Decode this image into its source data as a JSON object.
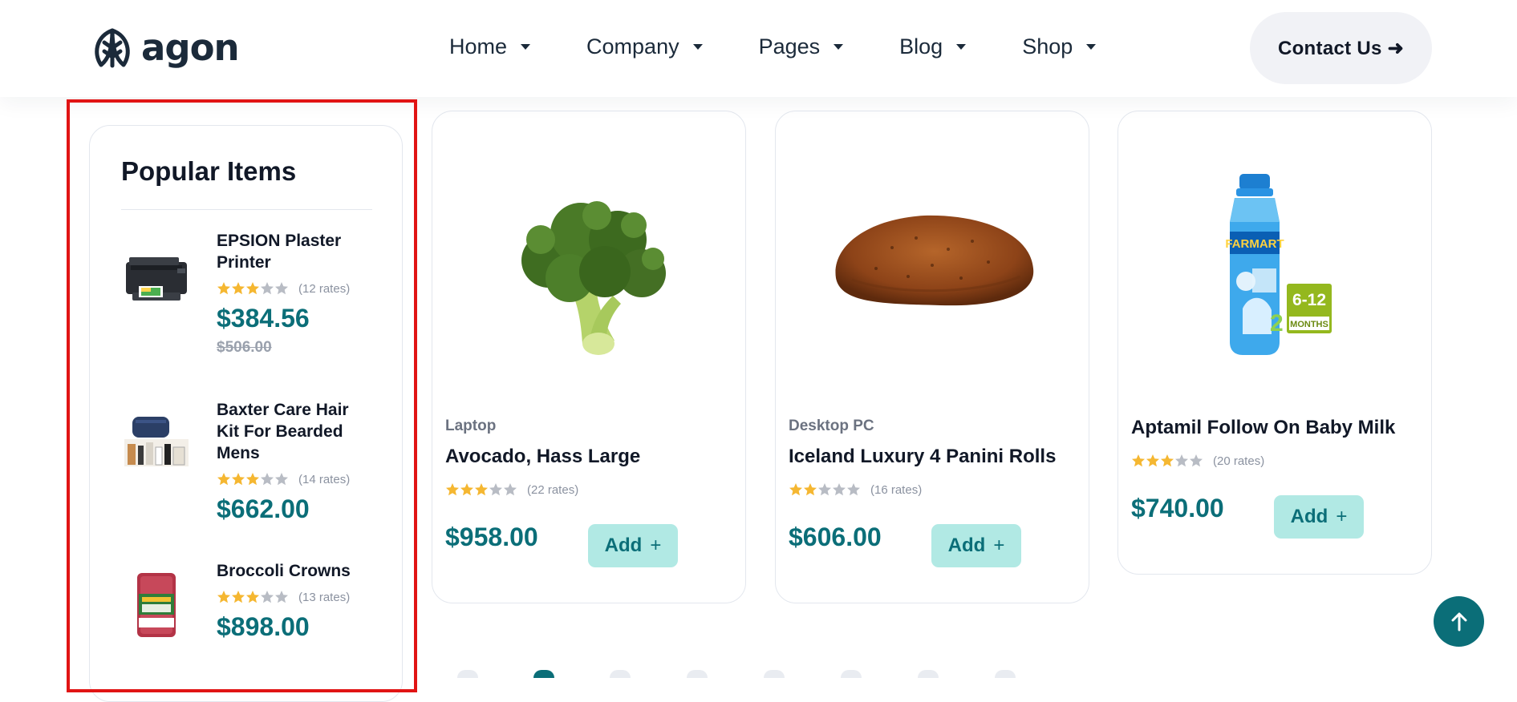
{
  "brand": {
    "name": "agon"
  },
  "nav": {
    "items": [
      {
        "label": "Home"
      },
      {
        "label": "Company"
      },
      {
        "label": "Pages"
      },
      {
        "label": "Blog"
      },
      {
        "label": "Shop"
      }
    ],
    "contact_label": "Contact Us ➜"
  },
  "popular": {
    "title": "Popular Items",
    "items": [
      {
        "name": "EPSION Plaster Printer",
        "rating": 3,
        "rates": "(12 rates)",
        "price": "$384.56",
        "old_price": "$506.00"
      },
      {
        "name": "Baxter Care Hair Kit For Bearded Mens",
        "rating": 3,
        "rates": "(14 rates)",
        "price": "$662.00"
      },
      {
        "name": "Broccoli Crowns",
        "rating": 3,
        "rates": "(13 rates)",
        "price": "$898.00"
      }
    ]
  },
  "products": [
    {
      "category": "Laptop",
      "name": "Avocado, Hass Large",
      "rating": 3,
      "rates": "(22 rates)",
      "price": "$958.00",
      "add_label": "Add",
      "add_icon": "+"
    },
    {
      "category": "Desktop PC",
      "name": "Iceland Luxury 4 Panini Rolls",
      "rating": 2,
      "rates": "(16 rates)",
      "price": "$606.00",
      "add_label": "Add",
      "add_icon": "+"
    },
    {
      "category": "",
      "name": "Aptamil Follow On Baby Milk",
      "rating": 3,
      "rates": "(20 rates)",
      "price": "$740.00",
      "add_label": "Add",
      "add_icon": "+"
    }
  ],
  "milk_label": {
    "line1": "6-12",
    "line2": "MONTHS",
    "brand": "FARMART"
  },
  "colors": {
    "accent": "#0b6e78",
    "star_on": "#f5b731",
    "star_off": "#b8bcc4",
    "add_bg": "#b1e9e4",
    "highlight": "#e11414"
  }
}
